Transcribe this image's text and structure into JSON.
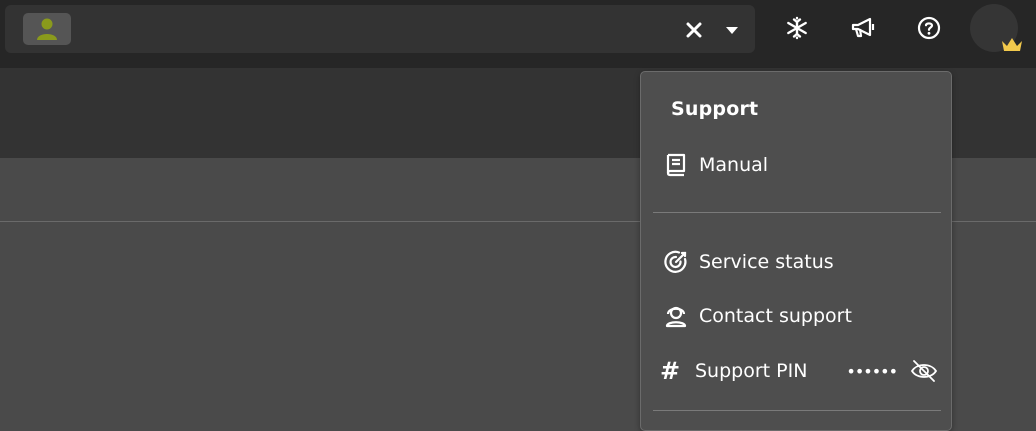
{
  "topbar": {
    "selector": {
      "avatar_icon": "user-icon",
      "clear_icon": "close-icon",
      "caret_icon": "caret-down-icon"
    },
    "icons": [
      "snowflake-icon",
      "megaphone-icon",
      "help-icon"
    ],
    "user_avatar_badge": "crown-icon",
    "colors": {
      "user_icon": "#8a9a1c",
      "crown": "#f2c94c"
    }
  },
  "support_menu": {
    "title": "Support",
    "items": [
      {
        "label": "Manual",
        "icon": "book-icon"
      },
      {
        "label": "Service status",
        "icon": "target-icon"
      },
      {
        "label": "Contact support",
        "icon": "support-agent-icon"
      }
    ],
    "pin": {
      "label": "Support PIN",
      "icon": "hash-icon",
      "masked_value": "••••••",
      "toggle_icon": "eye-off-icon"
    }
  }
}
